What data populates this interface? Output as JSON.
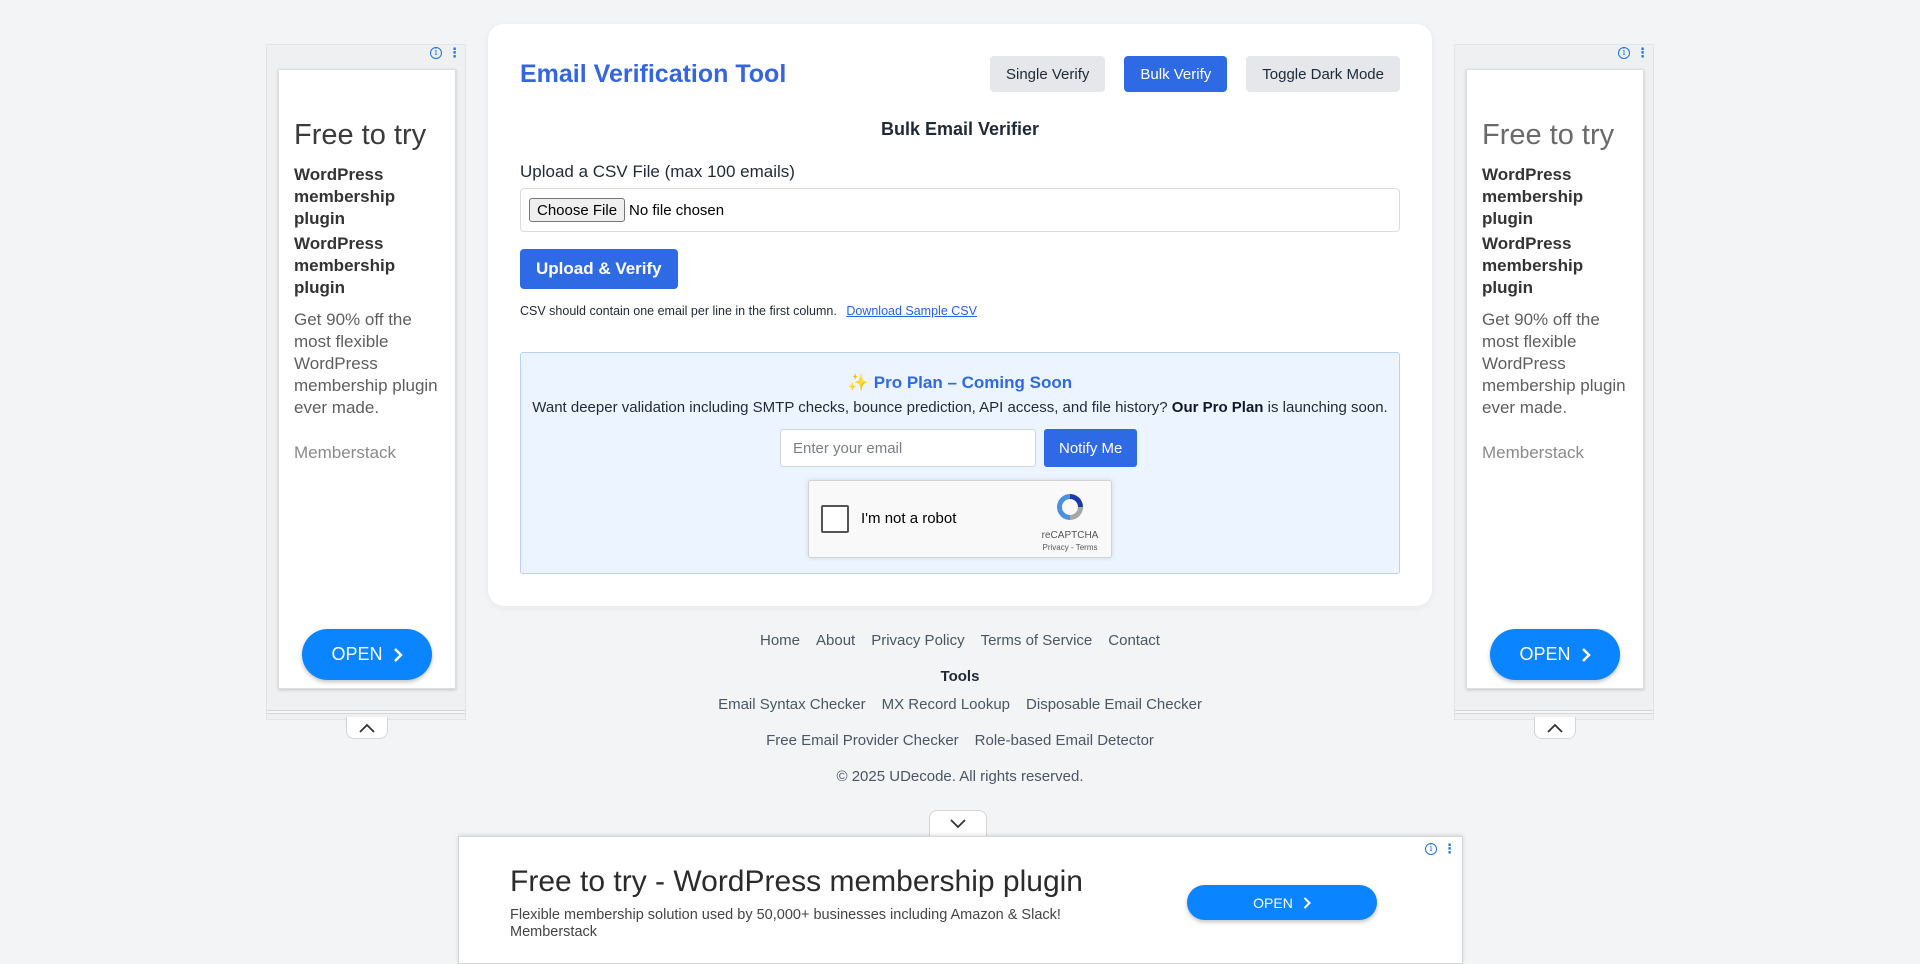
{
  "header": {
    "title": "Email Verification Tool",
    "buttons": {
      "single": "Single Verify",
      "bulk": "Bulk Verify",
      "dark": "Toggle Dark Mode"
    }
  },
  "bulk": {
    "section_title": "Bulk Email Verifier",
    "upload_label": "Upload a CSV File (max 100 emails)",
    "file_button": "Choose File",
    "file_status": "No file chosen",
    "submit_label": "Upload & Verify",
    "hint": "CSV should contain one email per line in the first column.",
    "sample_link": "Download Sample CSV"
  },
  "pro": {
    "title": "✨ Pro Plan – Coming Soon",
    "desc_before": "Want deeper validation including SMTP checks, bounce prediction, API access, and file history?",
    "desc_bold": "Our Pro Plan",
    "desc_after": "is launching soon.",
    "email_placeholder": "Enter your email",
    "notify_label": "Notify Me"
  },
  "captcha": {
    "label": "I'm not a robot",
    "brand": "reCAPTCHA",
    "links": "Privacy - Terms"
  },
  "footer": {
    "links": [
      "Home",
      "About",
      "Privacy Policy",
      "Terms of Service",
      "Contact"
    ],
    "tools_title": "Tools",
    "tools_row1": [
      "Email Syntax Checker",
      "MX Record Lookup",
      "Disposable Email Checker"
    ],
    "tools_row2": [
      "Free Email Provider Checker",
      "Role-based Email Detector"
    ],
    "copyright": "© 2025 UDecode. All rights reserved."
  },
  "side_ad": {
    "headline": "Free to try",
    "sub1": "WordPress membership plugin",
    "sub2": "WordPress membership plugin",
    "desc": "Get 90% off the most flexible WordPress membership plugin ever made.",
    "advertiser": "Memberstack",
    "open_label": "OPEN",
    "info_badge": "i",
    "menu_badge": "⋮"
  },
  "bottom_ad": {
    "headline": "Free to try - WordPress membership plugin",
    "desc": "Flexible membership solution used by 50,000+ businesses including Amazon & Slack!",
    "advertiser": "Memberstack",
    "open_label": "OPEN"
  },
  "colors": {
    "accent": "#2f6ae5",
    "title_blue": "#3366e0",
    "ad_blue": "#0a84ff",
    "page_bg": "#f3f4f6",
    "pro_bg": "#ecf4ff"
  }
}
